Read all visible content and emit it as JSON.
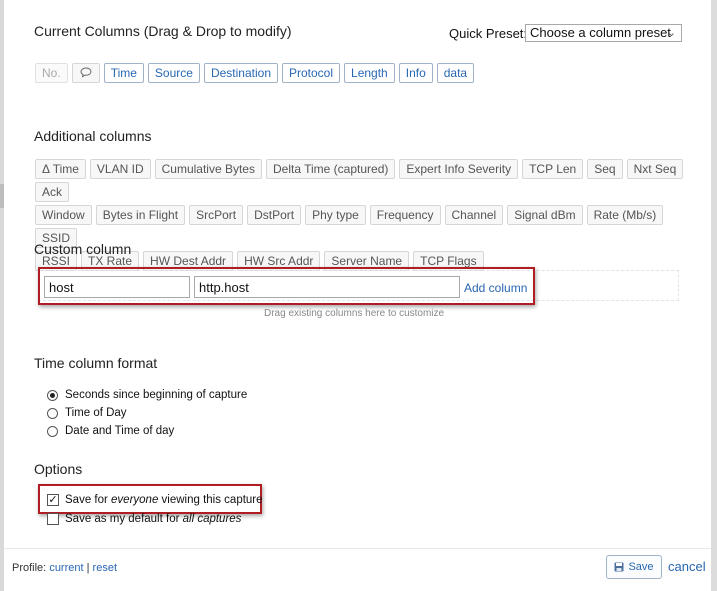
{
  "header": {
    "title": "Current Columns (Drag & Drop to modify)",
    "preset_label": "Quick Preset:",
    "preset_value": "Choose a column preset"
  },
  "current_columns": [
    {
      "label": "No.",
      "state": "disabled"
    },
    {
      "label": "",
      "icon": "comment-icon",
      "state": "normal"
    },
    {
      "label": "Time",
      "state": "current"
    },
    {
      "label": "Source",
      "state": "current"
    },
    {
      "label": "Destination",
      "state": "current"
    },
    {
      "label": "Protocol",
      "state": "current"
    },
    {
      "label": "Length",
      "state": "current"
    },
    {
      "label": "Info",
      "state": "current"
    },
    {
      "label": "data",
      "state": "current"
    }
  ],
  "additional": {
    "title": "Additional columns",
    "rows": [
      [
        "Δ Time",
        "VLAN ID",
        "Cumulative Bytes",
        "Delta Time (captured)",
        "Expert Info Severity",
        "TCP Len",
        "Seq",
        "Nxt Seq",
        "Ack"
      ],
      [
        "Window",
        "Bytes in Flight",
        "SrcPort",
        "DstPort",
        "Phy type",
        "Frequency",
        "Channel",
        "Signal dBm",
        "Rate (Mb/s)",
        "SSID"
      ],
      [
        "RSSI",
        "TX Rate",
        "HW Dest Addr",
        "HW Src Addr",
        "Server Name",
        "TCP Flags"
      ]
    ]
  },
  "custom": {
    "title": "Custom column",
    "name_value": "host",
    "field_value": "http.host",
    "add_label": "Add column",
    "hint": "Drag existing columns here to customize"
  },
  "time_format": {
    "title": "Time column format",
    "options": [
      {
        "label": "Seconds since beginning of capture",
        "selected": true
      },
      {
        "label": "Time of Day",
        "selected": false
      },
      {
        "label": "Date and Time of day",
        "selected": false
      }
    ]
  },
  "options": {
    "title": "Options",
    "save_everyone": {
      "prefix": "Save for ",
      "em": "everyone",
      "suffix": " viewing this capture",
      "checked": true
    },
    "save_default": {
      "prefix": "Save as my default for ",
      "em": "all captures",
      "suffix": "",
      "checked": false
    }
  },
  "footer": {
    "profile_label": "Profile:",
    "profile_current": "current",
    "separator": "|",
    "profile_reset": "reset",
    "save_label": "Save",
    "cancel_label": "cancel"
  },
  "colors": {
    "link": "#2867b2",
    "highlight_border": "#b21d23"
  }
}
